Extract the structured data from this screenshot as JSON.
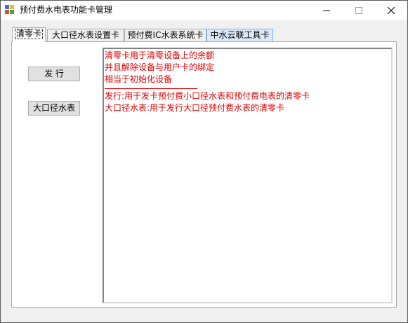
{
  "window": {
    "title": "预付费水电表功能卡管理",
    "icon": "app-window-icon"
  },
  "titlebar_buttons": [
    {
      "name": "minimize-icon"
    },
    {
      "name": "maximize-icon"
    },
    {
      "name": "close-icon"
    }
  ],
  "tabs": [
    {
      "label": "清零卡",
      "active": true
    },
    {
      "label": "大口径水表设置卡",
      "active": false
    },
    {
      "label": "预付费IC水表系统卡",
      "active": false
    },
    {
      "label": "中水云联工具卡",
      "active": false,
      "hover": true
    }
  ],
  "panel": {
    "buttons": {
      "issue": "发  行",
      "big_meter": "大口径水表"
    },
    "description_lines": [
      "清零卡用于清零设备上的余额",
      "并且解除设备与用户卡的绑定",
      "相当于初始化设备"
    ],
    "detail_lines": [
      "发行:用于发卡预付费小口径水表和预付费电表的清零卡",
      "大口径水表:用于发行大口径预付费水表的清零卡"
    ],
    "text_color": "#e00000"
  }
}
